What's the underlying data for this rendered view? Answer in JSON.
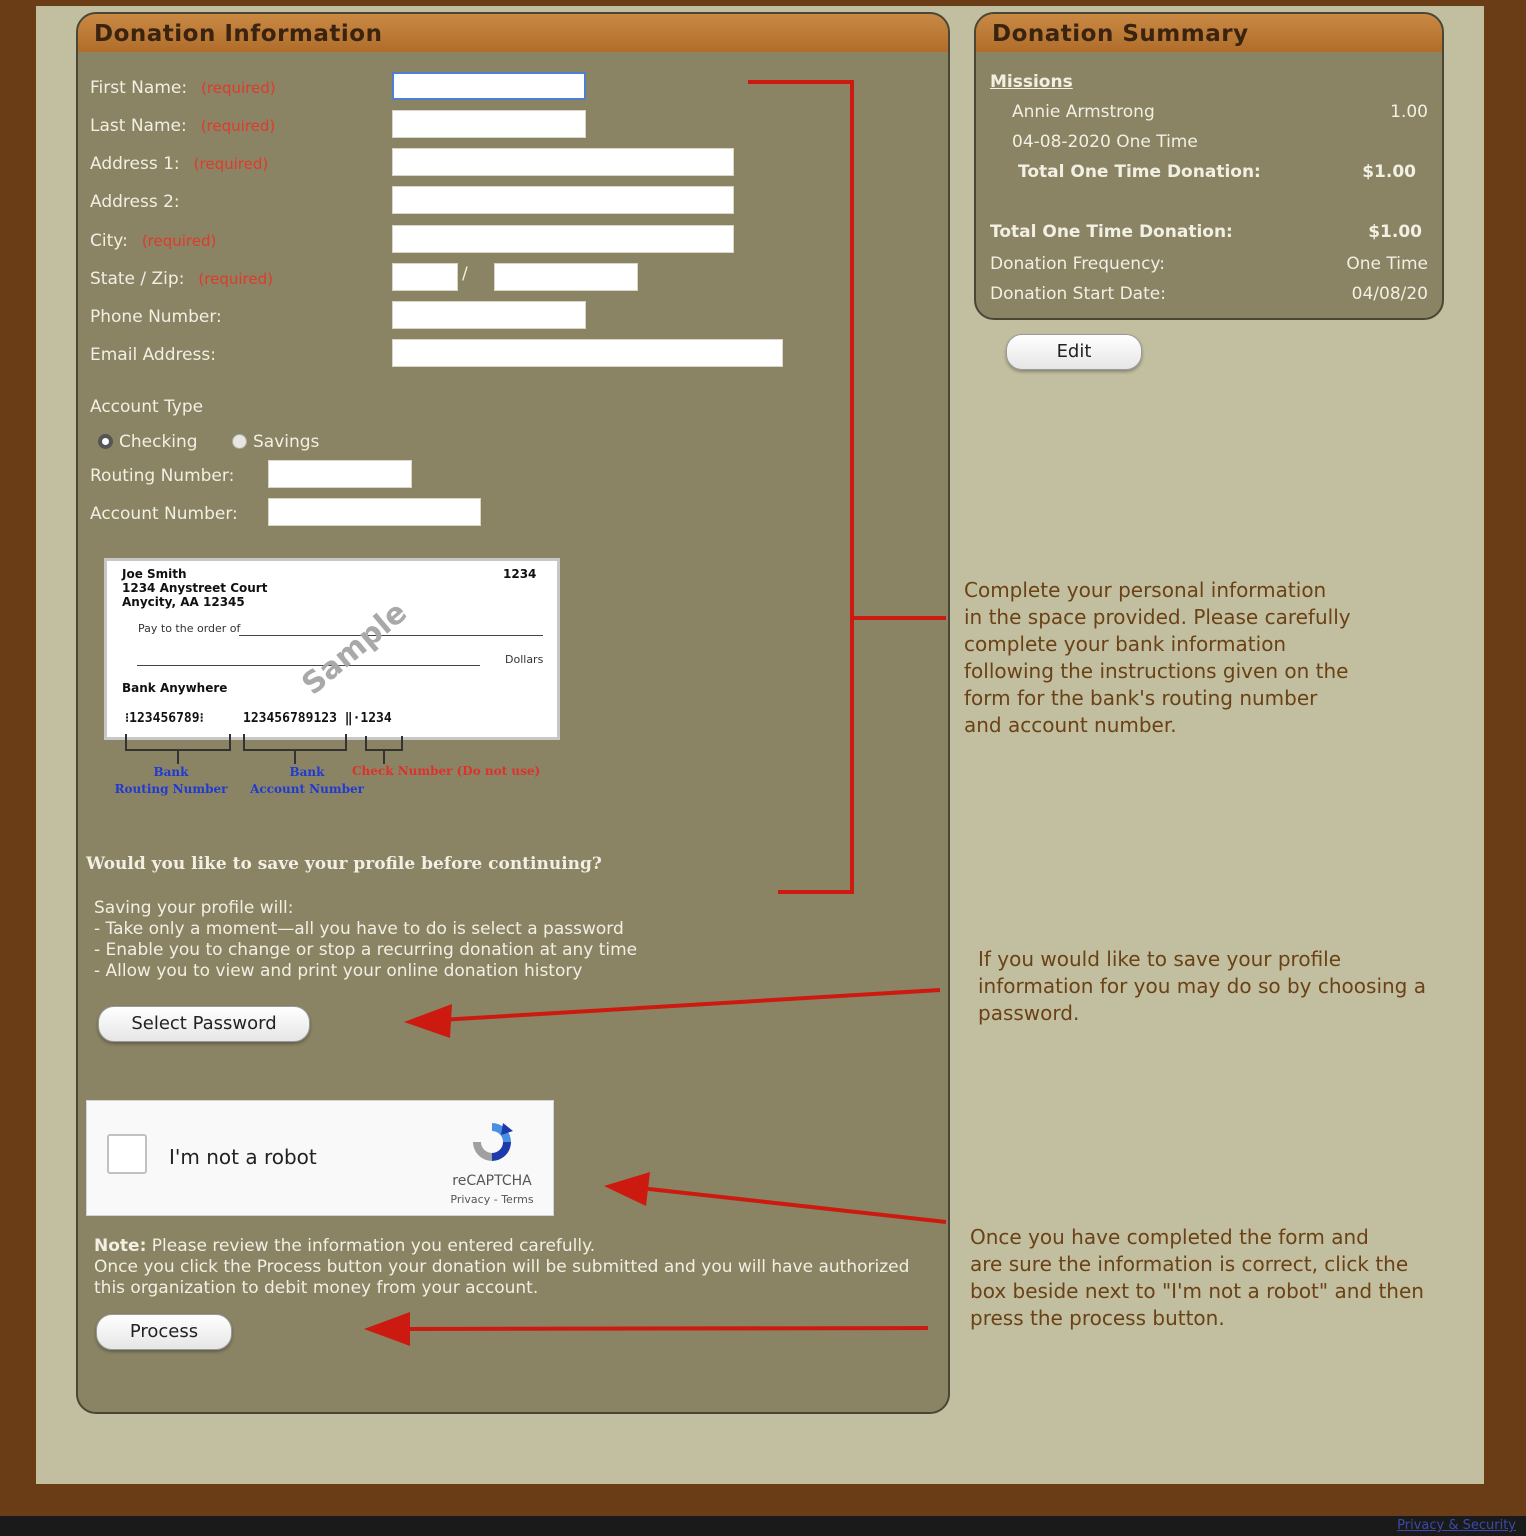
{
  "form": {
    "title": "Donation Information",
    "required": "(required)",
    "fields": {
      "first_name": "First Name:",
      "last_name": "Last Name:",
      "address1": "Address 1:",
      "address2": "Address 2:",
      "city": "City:",
      "state_zip": "State / Zip:",
      "state_zip_sep": "/",
      "phone": "Phone Number:",
      "email": "Email Address:"
    },
    "account_type": {
      "label": "Account Type",
      "options": [
        "Checking",
        "Savings"
      ],
      "selected": "Checking"
    },
    "routing_label": "Routing Number:",
    "account_label": "Account Number:",
    "check": {
      "name": "Joe Smith",
      "street": "1234 Anystreet Court",
      "city": "Anycity, AA 12345",
      "number": "1234",
      "pay_to": "Pay to the order of",
      "dollars": "Dollars",
      "bank": "Bank Anywhere",
      "watermark": "Sample",
      "micr_routing": "⁝123456789⁝",
      "micr_account": "123456789123 ‖⋅1234",
      "lbl_routing": "Bank\nRouting Number",
      "lbl_account": "Bank\nAccount Number",
      "lbl_check": "Check Number (Do not use)"
    },
    "save_question": "Would you like to save your profile before continuing?",
    "save_info": [
      "Saving your profile will:",
      "- Take only a moment—all you have to do is select a password",
      "- Enable you to change or stop a recurring donation at any time",
      "- Allow you to view and print your online donation history"
    ],
    "select_password_btn": "Select Password",
    "captcha": {
      "label": "I'm not a robot",
      "brand": "reCAPTCHA",
      "links": "Privacy - Terms"
    },
    "note_bold": "Note:",
    "note_line1": " Please review the information you entered carefully.",
    "note_line2": "Once you click the Process button your donation will be submitted and you will have authorized",
    "note_line3": "this organization to debit money from your account.",
    "process_btn": "Process"
  },
  "summary": {
    "title": "Donation Summary",
    "category": "Missions",
    "item_name": "Annie Armstrong",
    "item_amount": "1.00",
    "item_date": "04-08-2020 One Time",
    "subtotal_label": "Total One Time Donation:",
    "subtotal_value": "$1.00",
    "total_label": "Total One Time Donation:",
    "total_value": "$1.00",
    "freq_label": "Donation Frequency:",
    "freq_value": "One Time",
    "start_label": "Donation Start Date:",
    "start_value": "04/08/20",
    "edit_btn": "Edit"
  },
  "instructions": {
    "personal": [
      "Complete your personal information",
      "in the space provided.  Please carefully",
      "complete your bank information",
      "following the instructions given on the",
      "form for the bank's routing number",
      "and account number."
    ],
    "password": [
      "If you would like to save your profile",
      "information for you may do so by choosing a",
      "password."
    ],
    "process": [
      "Once you have completed the form and",
      "are sure the information is correct, click the",
      "box beside next to \"I'm not a robot\" and then",
      "press the process button."
    ]
  },
  "footer": {
    "link": "Privacy & Security"
  },
  "colors": {
    "panel": "#8a8465",
    "header": "#b06d2b",
    "background": "#c2bea0",
    "frame": "#6b3d17",
    "arrow": "#cc1a10"
  }
}
